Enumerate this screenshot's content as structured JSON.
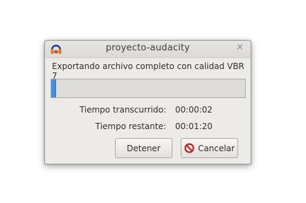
{
  "window": {
    "title": "proyecto-audacity",
    "close_glyph": "×",
    "app_icon": "audacity-headphones-icon"
  },
  "message": "Exportando archivo completo con calidad VBR 7",
  "progress": {
    "fraction": 0.025,
    "fill_color": "#4a90d9"
  },
  "elapsed": {
    "label": "Tiempo transcurrido:",
    "value": "00:00:02"
  },
  "remaining": {
    "label": "Tiempo restante:",
    "value": "00:01:20"
  },
  "buttons": {
    "stop_label": "Detener",
    "cancel_label": "Cancelar",
    "cancel_icon": "cancel-circle-icon"
  }
}
